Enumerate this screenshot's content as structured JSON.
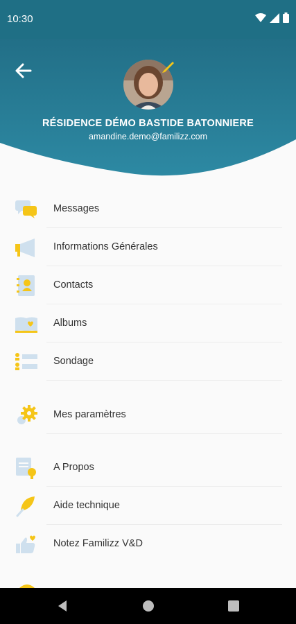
{
  "status_bar": {
    "time": "10:30"
  },
  "profile": {
    "name": "RÉSIDENCE DÉMO BASTIDE BATONNIERE",
    "email": "amandine.demo@familizz.com"
  },
  "menu": {
    "items": [
      {
        "label": "Messages",
        "icon": "chat-bubbles-icon"
      },
      {
        "label": "Informations Générales",
        "icon": "megaphone-icon"
      },
      {
        "label": "Contacts",
        "icon": "address-book-icon"
      },
      {
        "label": "Albums",
        "icon": "photo-album-icon"
      },
      {
        "label": "Sondage",
        "icon": "poll-icon"
      },
      {
        "label": "Mes paramètres",
        "icon": "gear-icon"
      },
      {
        "label": "A Propos",
        "icon": "document-badge-icon"
      },
      {
        "label": "Aide technique",
        "icon": "feather-icon"
      },
      {
        "label": "Notez Familizz V&D",
        "icon": "thumbs-up-heart-icon"
      }
    ]
  },
  "colors": {
    "header": "#2a7f98",
    "status_bar": "#1f6f85",
    "accent": "#f5c518",
    "icon_light": "#cfe0ee"
  }
}
